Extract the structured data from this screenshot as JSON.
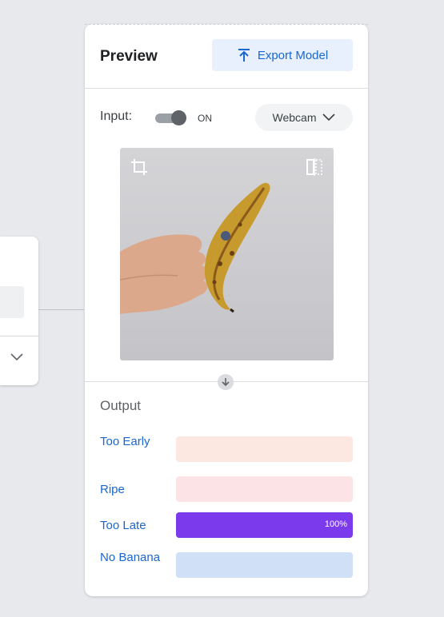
{
  "panel": {
    "title": "Preview",
    "export_label": "Export Model",
    "export_icon": "upload-icon"
  },
  "input": {
    "label": "Input:",
    "toggle_state": "ON",
    "source_value": "Webcam",
    "source_icon": "chevron-down-icon"
  },
  "preview": {
    "crop_icon": "crop-icon",
    "mirror_icon": "flip-icon"
  },
  "output": {
    "title": "Output",
    "classes": [
      {
        "label": "Too Early",
        "value": 0,
        "track_color": "#fce8e0",
        "fill_color": "#f6aea9",
        "pct_label": ""
      },
      {
        "label": "Ripe",
        "value": 0,
        "track_color": "#fce4e6",
        "fill_color": "#f28b82",
        "pct_label": ""
      },
      {
        "label": "Too Late",
        "value": 1,
        "track_color": "#e9defc",
        "fill_color": "#7c3aed",
        "pct_label": "100%"
      },
      {
        "label": "No Banana",
        "value": 0,
        "track_color": "#cfe0f7",
        "fill_color": "#4285f4",
        "pct_label": ""
      }
    ]
  }
}
